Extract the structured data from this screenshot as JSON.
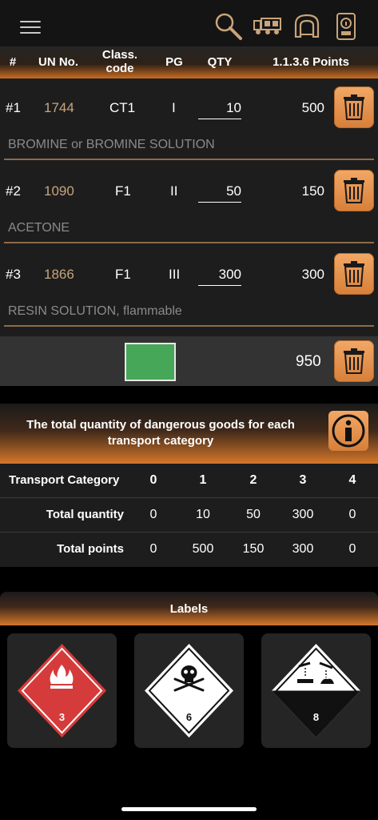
{
  "toolbar": {
    "menu_icon": "hamburger-menu-icon",
    "search_icon": "magnifier-icon",
    "truck_icon": "truck-icon",
    "tunnel_icon": "tunnel-icon",
    "info_icon": "device-info-icon"
  },
  "columns": {
    "num": "#",
    "un": "UN No.",
    "class": "Class. code",
    "pg": "PG",
    "qty": "QTY",
    "points": "1.1.3.6 Points"
  },
  "items": [
    {
      "num": "#1",
      "un": "1744",
      "class": "CT1",
      "pg": "I",
      "qty": "10",
      "points": "500",
      "name": "BROMINE or BROMINE SOLUTION"
    },
    {
      "num": "#2",
      "un": "1090",
      "class": "F1",
      "pg": "II",
      "qty": "50",
      "points": "150",
      "name": "ACETONE"
    },
    {
      "num": "#3",
      "un": "1866",
      "class": "F1",
      "pg": "III",
      "qty": "300",
      "points": "300",
      "name": "RESIN SOLUTION, flammable"
    }
  ],
  "total": {
    "points": "950",
    "status_color": "#46a758"
  },
  "transport_banner": {
    "text": "The total quantity of dangerous goods for each transport category"
  },
  "transport_table": {
    "header_label": "Transport Category",
    "categories": [
      "0",
      "1",
      "2",
      "3",
      "4"
    ],
    "rows": [
      {
        "label": "Total quantity",
        "values": [
          "0",
          "10",
          "50",
          "300",
          "0"
        ]
      },
      {
        "label": "Total points",
        "values": [
          "0",
          "500",
          "150",
          "300",
          "0"
        ]
      }
    ]
  },
  "labels_banner": {
    "text": "Labels"
  },
  "hazard_labels": [
    {
      "number": "3",
      "icon": "flame-icon",
      "color": "#d63b3b"
    },
    {
      "number": "6",
      "icon": "skull-crossbones-icon",
      "color": "#ffffff"
    },
    {
      "number": "8",
      "icon": "corrosive-icon",
      "color": "#ffffff"
    }
  ],
  "colors": {
    "accent": "#e08a3e",
    "un_text": "#c8a57d",
    "background": "#1d1d1d"
  }
}
